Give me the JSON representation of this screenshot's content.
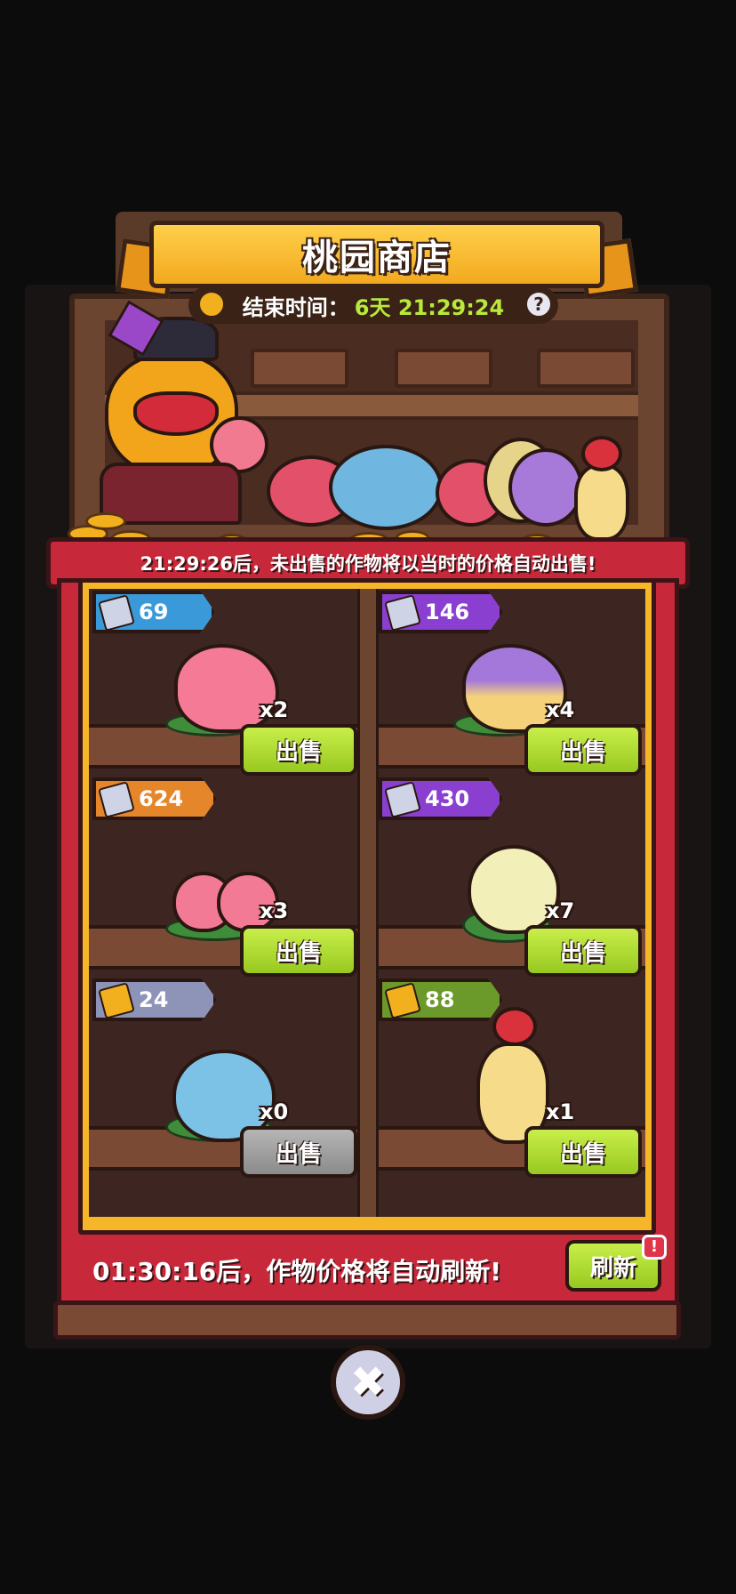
{
  "header": {
    "title": "桃园商店",
    "end_time_label": "结束时间：",
    "end_time_value": "6天 21:29:24",
    "help_glyph": "?"
  },
  "notice": {
    "auto_sell_text": "21:29:26后，未出售的作物将以当时的价格自动出售!"
  },
  "items": [
    {
      "price": "69",
      "qty": "x2",
      "sell_label": "出售",
      "tag_color": "#3a9ad9",
      "crop": "peach",
      "enabled": true
    },
    {
      "price": "146",
      "qty": "x4",
      "sell_label": "出售",
      "tag_color": "#8a3fd1",
      "crop": "golden-peach",
      "enabled": true
    },
    {
      "price": "624",
      "qty": "x3",
      "sell_label": "出售",
      "tag_color": "#e6862a",
      "crop": "twin-peach",
      "enabled": true
    },
    {
      "price": "430",
      "qty": "x7",
      "sell_label": "出售",
      "tag_color": "#8a3fd1",
      "crop": "white-cabbage",
      "enabled": true
    },
    {
      "price": "24",
      "qty": "x0",
      "sell_label": "出售",
      "tag_color": "#8e93b8",
      "crop": "blue-cabbage",
      "enabled": false
    },
    {
      "price": "88",
      "qty": "x1",
      "sell_label": "出售",
      "tag_color": "#6c9a2a",
      "crop": "ginseng",
      "enabled": true
    }
  ],
  "footer": {
    "refresh_text": "01:30:16后，作物价格将自动刷新!",
    "refresh_label": "刷新",
    "alert_glyph": "!"
  },
  "close": {
    "glyph": "✖"
  },
  "colors": {
    "accent_green": "#b8ea3a",
    "counter_red": "#c7283a",
    "frame_gold": "#f5b62a"
  }
}
